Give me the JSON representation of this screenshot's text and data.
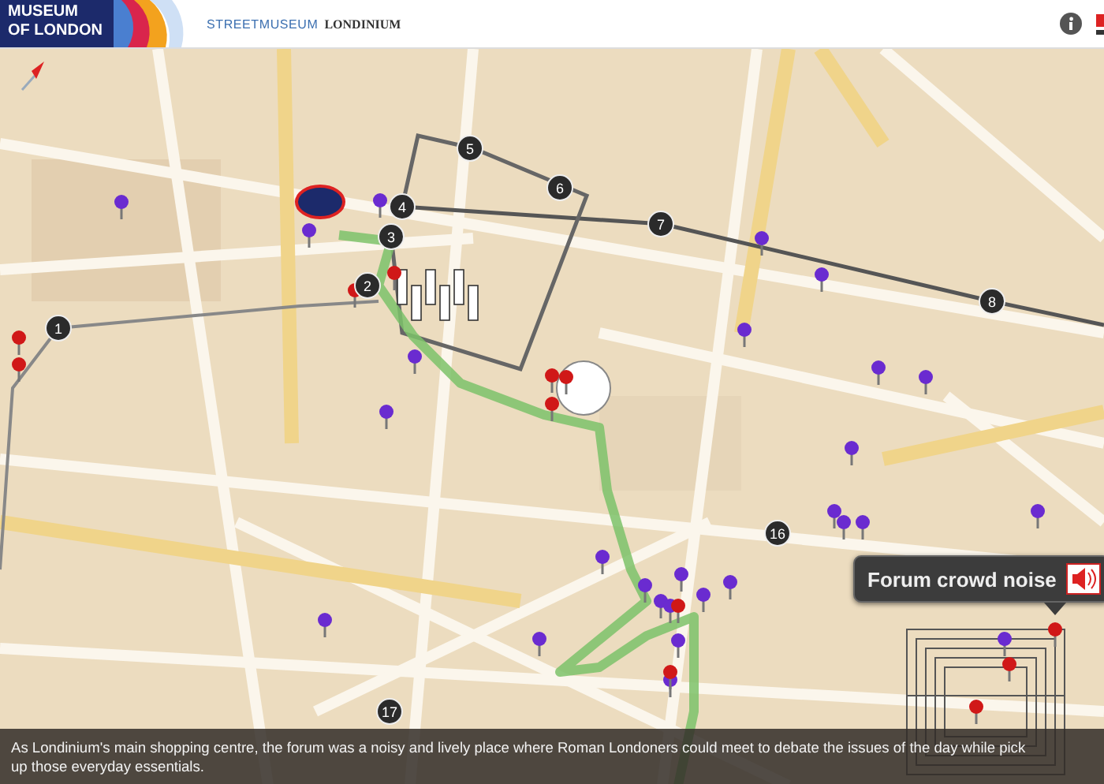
{
  "header": {
    "logo_lines": [
      "MUSEUM",
      "OF LONDON"
    ],
    "brand": "STREETMUSEUM",
    "title": "LONDINIUM"
  },
  "map": {
    "route_stops": [
      "1",
      "2",
      "3",
      "4",
      "5",
      "6",
      "7",
      "8",
      "16",
      "17"
    ]
  },
  "callout": {
    "label": "Forum crowd noise"
  },
  "caption_lines": [
    "As Londinium's main shopping centre, the forum was a noisy and lively place where Roman Londoners could meet to debate the issues of the day while pick",
    "up those everyday essentials."
  ]
}
